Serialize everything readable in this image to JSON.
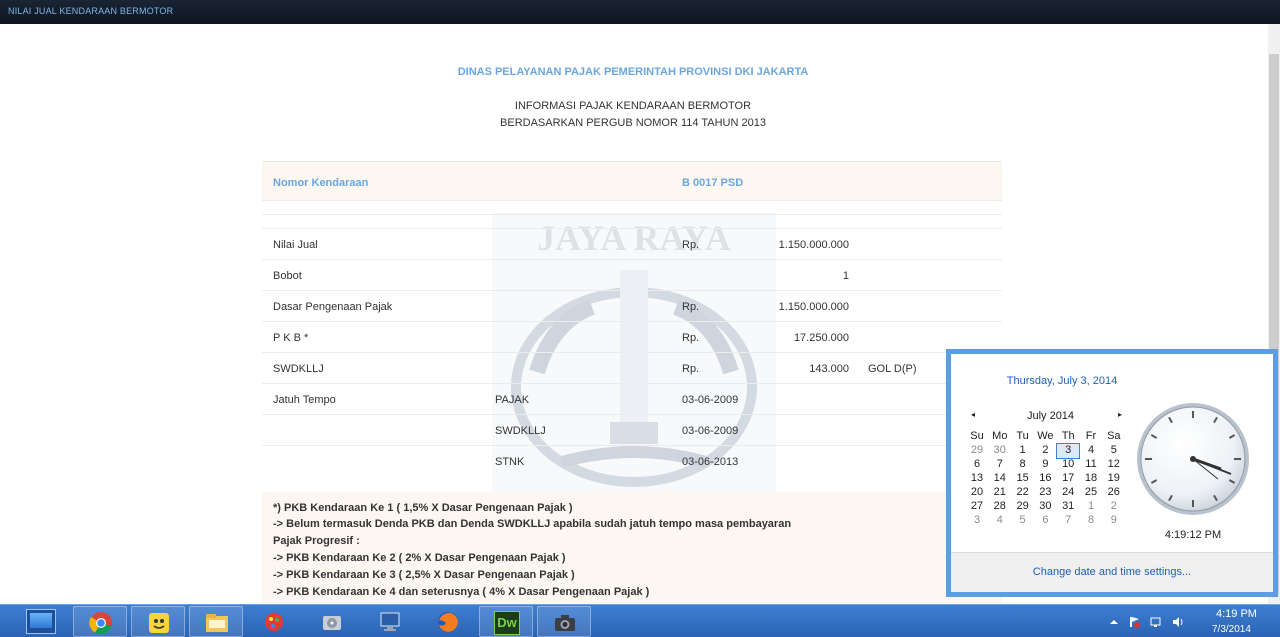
{
  "window": {
    "title": "NILAI JUAL KENDARAAN BERMOTOR"
  },
  "header": {
    "agency": "DINAS PELAYANAN PAJAK PEMERINTAH PROVINSI DKI JAKARTA",
    "line1": "INFORMASI PAJAK KENDARAAN BERMOTOR",
    "line2": "BERDASARKAN PERGUB NOMOR 114 TAHUN 2013"
  },
  "vehicle": {
    "label": "Nomor Kendaraan",
    "value": "B 0017 PSD"
  },
  "watermark": {
    "text": "JAYA RAYA"
  },
  "rows": [
    {
      "label": "Nilai Jual",
      "sub": "",
      "currency": "Rp.",
      "amount": "1.150.000.000",
      "extra": ""
    },
    {
      "label": "Bobot",
      "sub": "",
      "currency": "",
      "amount": "1",
      "extra": ""
    },
    {
      "label": "Dasar Pengenaan Pajak",
      "sub": "",
      "currency": "Rp.",
      "amount": "1.150.000.000",
      "extra": ""
    },
    {
      "label": "P K B *",
      "sub": "",
      "currency": "Rp.",
      "amount": "17.250.000",
      "extra": ""
    },
    {
      "label": "SWDKLLJ",
      "sub": "",
      "currency": "Rp.",
      "amount": "143.000",
      "extra": "GOL D(P)"
    },
    {
      "label": "Jatuh Tempo",
      "sub": "PAJAK",
      "currency": "03-06-2009",
      "amount": "",
      "extra": ""
    },
    {
      "label": "",
      "sub": "SWDKLLJ",
      "currency": "03-06-2009",
      "amount": "",
      "extra": ""
    },
    {
      "label": "",
      "sub": "STNK",
      "currency": "03-06-2013",
      "amount": "",
      "extra": ""
    }
  ],
  "notes": [
    "*) PKB Kendaraan Ke 1 ( 1,5% X Dasar Pengenaan Pajak )",
    "-> Belum termasuk Denda PKB dan Denda SWDKLLJ apabila sudah jatuh tempo masa pembayaran",
    "Pajak Progresif :",
    "-> PKB Kendaraan Ke 2 ( 2% X Dasar Pengenaan Pajak )",
    "-> PKB Kendaraan Ke 3 ( 2,5% X Dasar Pengenaan Pajak )",
    "-> PKB Kendaraan Ke 4 dan seterusnya ( 4% X Dasar Pengenaan Pajak )"
  ],
  "calendar": {
    "full_date": "Thursday, July 3, 2014",
    "month": "July 2014",
    "prev": "◂",
    "next": "▸",
    "weekdays": [
      "Su",
      "Mo",
      "Tu",
      "We",
      "Th",
      "Fr",
      "Sa"
    ],
    "weeks": [
      [
        "29",
        "30",
        "1",
        "2",
        "3",
        "4",
        "5"
      ],
      [
        "6",
        "7",
        "8",
        "9",
        "10",
        "11",
        "12"
      ],
      [
        "13",
        "14",
        "15",
        "16",
        "17",
        "18",
        "19"
      ],
      [
        "20",
        "21",
        "22",
        "23",
        "24",
        "25",
        "26"
      ],
      [
        "27",
        "28",
        "29",
        "30",
        "31",
        "1",
        "2"
      ],
      [
        "3",
        "4",
        "5",
        "6",
        "7",
        "8",
        "9"
      ]
    ],
    "today": "3",
    "clock_time": "4:19:12 PM",
    "change_link": "Change date and time settings..."
  },
  "taskbar": {
    "apps": [
      "chrome-icon",
      "messenger-icon",
      "explorer-icon",
      "paint-icon",
      "disk-icon",
      "network-computer-icon",
      "firefox-icon",
      "dreamweaver-icon",
      "camera-icon"
    ],
    "dreamweaver_label": "Dw",
    "time": "4:19 PM",
    "date": "7/3/2014"
  }
}
